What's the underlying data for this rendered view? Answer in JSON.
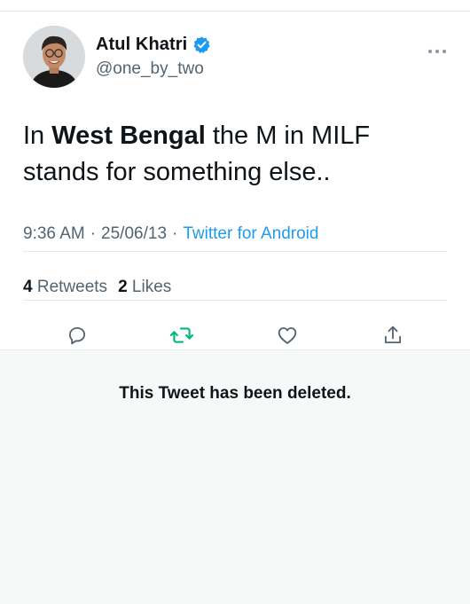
{
  "tweet": {
    "author": {
      "display_name": "Atul Khatri",
      "handle": "@one_by_two",
      "verified": true
    },
    "text": {
      "part1": "In ",
      "bold": "West Bengal",
      "part2": " the M in MILF stands for something else.."
    },
    "meta": {
      "time": "9:36 AM",
      "date": "25/06/13",
      "source": "Twitter for Android",
      "separator": "·"
    },
    "stats": {
      "retweets_count": "4",
      "retweets_label": "Retweets",
      "likes_count": "2",
      "likes_label": "Likes"
    },
    "actions": {
      "reply_icon": "reply-icon",
      "retweet_icon": "retweet-icon",
      "like_icon": "heart-icon",
      "share_icon": "share-icon"
    }
  },
  "deleted_notice": "This Tweet has been deleted.",
  "colors": {
    "accent": "#1d9bf0",
    "retweet_green": "#00ba7c",
    "secondary_text": "#536471",
    "primary_text": "#0f1419",
    "panel_bg": "#f7f9f9"
  }
}
